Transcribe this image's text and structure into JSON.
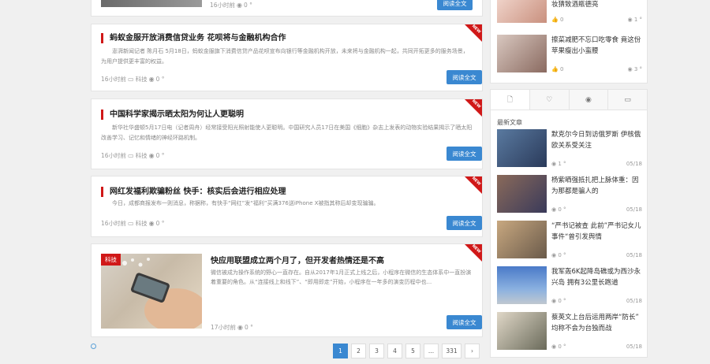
{
  "articles": [
    {
      "meta_time": "16小时前",
      "views": "0 °",
      "read_label": "阅读全文"
    },
    {
      "badge": "NEW",
      "title": "蚂蚁金服开放消费信贷业务 花呗将与金融机构合作",
      "summary": "澎湃新闻记者 陈月石 5月18日，蚂蚁金服旗下消费信贷产品花呗宣布向银行等金融机构开放，未来将与金融机构一起，共同开拓更多的服务场景，为用户提供更丰富的权益。",
      "meta_time": "16小时前",
      "category": "科技",
      "views": "0 °",
      "read_label": "阅读全文"
    },
    {
      "badge": "NEW",
      "title": "中国科学家揭示晒太阳为何让人更聪明",
      "summary": "新华社华盛顿5月17日电（记者周舟）经常接受阳光照射能使人更聪明。中国研究人员17日在美国《细胞》杂志上发表的动物实验结果揭示了晒太阳改善学习、记忆和情绪的神经环路机制。",
      "meta_time": "16小时前",
      "category": "科技",
      "views": "0 °",
      "read_label": "阅读全文"
    },
    {
      "badge": "NEW",
      "title": "网红发福利欺骗粉丝 快手：核实后会进行相应处理",
      "summary": "今日，成都商报发布一则消息，称据称，有快手“网红”发“福利”买满376送iPhone X被指其称后却变现骗骗。",
      "meta_time": "16小时前",
      "category": "科技",
      "views": "0 °",
      "read_label": "阅读全文"
    },
    {
      "badge": "NEW",
      "category_tag": "科技",
      "title": "快应用联盟成立两个月了，但开发者热情还是不高",
      "summary": "微信被成为操作系统的野心一直存在。自从2017年1月正式上线之后，小程序在微信的生态体系中一直扮演着重要的角色。从“连接线上和线下”、“即用即走”开始，小程序在一年多的演变历程中也...",
      "meta_time": "17小时前",
      "views": "0 °",
      "read_label": "阅读全文"
    }
  ],
  "pagination": [
    "1",
    "2",
    "3",
    "4",
    "5",
    "...",
    "331",
    "›"
  ],
  "side_top": [
    {
      "title": "妆猜致酒瓶德亮",
      "likes": "0",
      "views": "1 °"
    },
    {
      "title": "擦菜减肥不忘口吃零食 竟这份苹果瘦出小蛮腰",
      "likes": "0",
      "views": "3 °"
    }
  ],
  "side_tabs": [
    "file-icon",
    "heart-icon",
    "eye-icon",
    "comment-icon"
  ],
  "side_heading": "最新文章",
  "side_latest": [
    {
      "title": "默克尔今日到访俄罗斯 伊核俄欧关系受关注",
      "views": "1 °",
      "date": "05/18"
    },
    {
      "title": "杨紫晒强抵扎把上脉体重：因为那都是骗人的",
      "views": "0 °",
      "date": "05/18"
    },
    {
      "title": "“严书记被查 此前”严书记女儿事件“曾引发舆情",
      "views": "0 °",
      "date": "05/18"
    },
    {
      "title": "我军轰6K起降岛礁或为西沙永兴岛 拥有3公里长跑道",
      "views": "0 °",
      "date": "05/18"
    },
    {
      "title": "蔡英文上台后运用两岸“防长” 均称不会为台独而战",
      "views": "0 °",
      "date": "05/18"
    }
  ],
  "colors": {
    "accent_red": "#d01818",
    "button_blue": "#3a88d1"
  }
}
